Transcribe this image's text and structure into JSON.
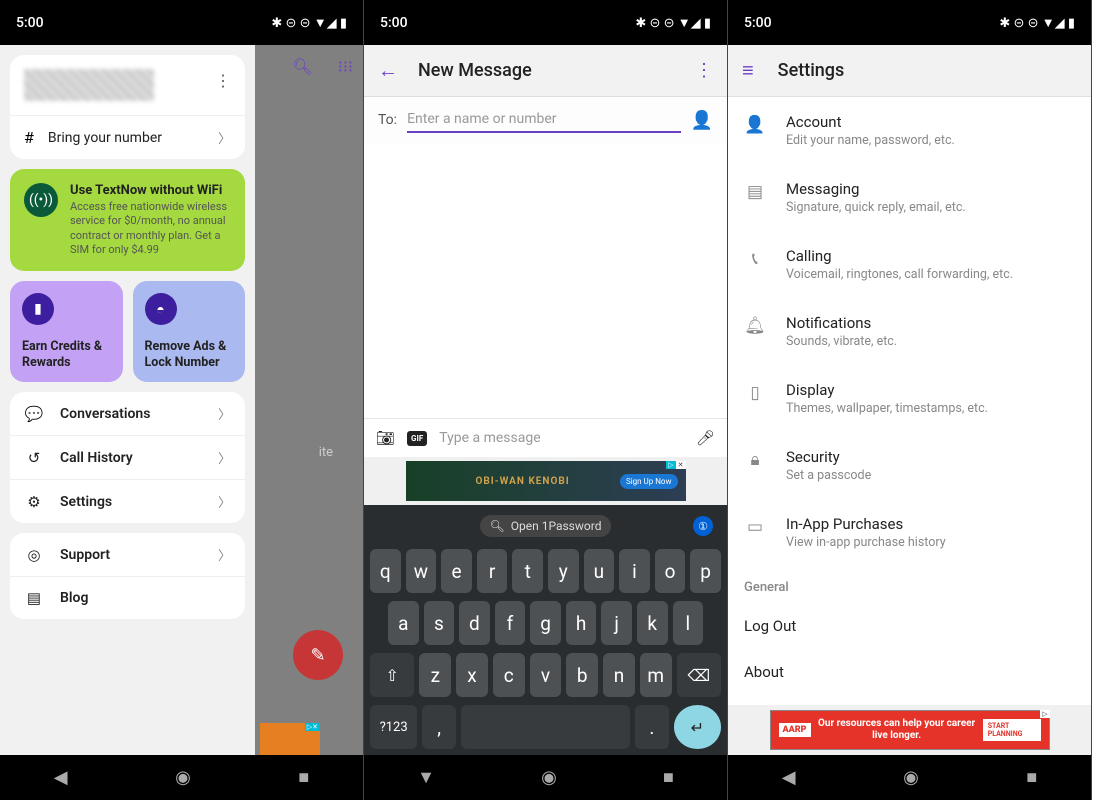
{
  "status_time": "5:00",
  "phone1": {
    "drawer": {
      "bring_number": "Bring your number",
      "promo_title": "Use TextNow without WiFi",
      "promo_sub": "Access free nationwide wireless service for $0/month, no annual contract or monthly plan. Get a SIM for only $4.99",
      "tile1": "Earn Credits & Rewards",
      "tile2": "Remove Ads & Lock Number",
      "menu": {
        "conversations": "Conversations",
        "call_history": "Call History",
        "settings": "Settings",
        "support": "Support",
        "blog": "Blog"
      }
    },
    "bg_text": "ite"
  },
  "phone2": {
    "title": "New Message",
    "to_label": "To:",
    "to_placeholder": "Enter a name or number",
    "compose_placeholder": "Type a message",
    "gif": "GIF",
    "ad": {
      "title": "OBI-WAN KENOBI",
      "cta": "Sign Up Now"
    },
    "onepass": "Open 1Password",
    "keyboard": {
      "r1": [
        "q",
        "w",
        "e",
        "r",
        "t",
        "y",
        "u",
        "i",
        "o",
        "p"
      ],
      "r2": [
        "a",
        "s",
        "d",
        "f",
        "g",
        "h",
        "j",
        "k",
        "l"
      ],
      "r3_shift": "⇧",
      "r3": [
        "z",
        "x",
        "c",
        "v",
        "b",
        "n",
        "m"
      ],
      "r3_del": "⌫",
      "r4_sym": "?123",
      "r4_comma": ",",
      "r4_period": ".",
      "r4_enter": "↵"
    }
  },
  "phone3": {
    "title": "Settings",
    "items": [
      {
        "t": "Account",
        "s": "Edit your name, password, etc."
      },
      {
        "t": "Messaging",
        "s": "Signature, quick reply, email, etc."
      },
      {
        "t": "Calling",
        "s": "Voicemail, ringtones, call forwarding, etc."
      },
      {
        "t": "Notifications",
        "s": "Sounds, vibrate, etc."
      },
      {
        "t": "Display",
        "s": "Themes, wallpaper, timestamps, etc."
      },
      {
        "t": "Security",
        "s": "Set a passcode"
      },
      {
        "t": "In-App Purchases",
        "s": "View in-app purchase history"
      }
    ],
    "section": "General",
    "logout": "Log Out",
    "about": "About",
    "ad": {
      "logo": "AARP",
      "text": "Our resources can help your career live longer.",
      "cta": "START PLANNING"
    }
  }
}
